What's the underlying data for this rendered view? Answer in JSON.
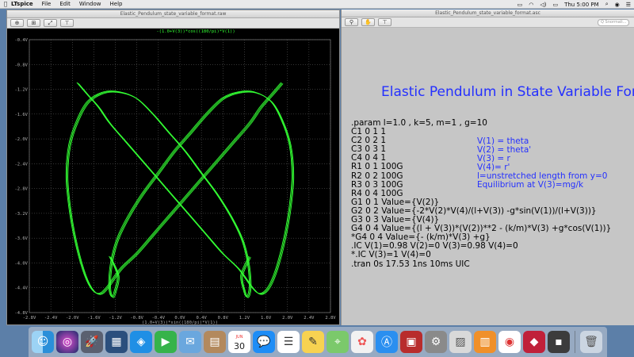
{
  "menubar": {
    "items": [
      "LTspice",
      "File",
      "Edit",
      "Window",
      "Help"
    ],
    "clock": "Thu 5:00 PM"
  },
  "waveform_window": {
    "title": "Elastic_Pendulum_state_variable_format.raw",
    "trace_label_top": "-(1.0+V(3))*cos((180/pi)*V(1))",
    "trace_label_bottom": "(1.0+V(3))*sin((180/pi)*V(1))",
    "trace_color": "#33ff33"
  },
  "schematic_window": {
    "title": "Elastic_Pendulum_state_variable_format.asc",
    "search_placeholder": "Q  Snormali...",
    "heading": "Elastic Pendulum in State Variable Forma",
    "netlist": [
      ".param l=1.0 , k=5, m=1 , g=10",
      "C1 0 1 1",
      "C2 0 2 1",
      "C3 0 3 1",
      "C4 0 4 1",
      "R1 0 1 100G",
      "R2 0 2 100G",
      "R3 0 3 100G",
      "R4 0 4 100G",
      "G1 0 1 Value={V(2)}",
      "G2 0 2 Value={-2*V(2)*V(4)/(l+V(3)) -g*sin(V(1))/(l+V(3))}",
      "G3 0 3 Value={V(4)}",
      "G4 0 4 Value={(l + V(3))*(V(2))**2 - (k/m)*V(3) +g*cos(V(1))}",
      "*G4 0 4 Value={- (k/m)*V(3) +g}",
      ".IC V(1)=0.98    V(2)=0  V(3)=0.98 V(4)=0",
      "*.IC  V(3)=1 V(4)=0",
      ".tran 0s 17.53 1ns  10ms UIC"
    ],
    "notes": [
      "V(1) = theta",
      "V(2) = theta'",
      "V(3) = r",
      "V(4)= r'",
      "l=unstretched length from y=0",
      "Equilibrium at V(3)=mg/k"
    ],
    "text_color": "#2430ff"
  },
  "chart_data": {
    "type": "line",
    "title": "-(1.0+V(3))*cos((180/pi)*V(1))",
    "xlabel": "(1.0+V(3))*sin((180/pi)*V(1))",
    "ylabel": "",
    "xlim": [
      -2.8,
      2.8
    ],
    "ylim": [
      -4.8,
      -0.4
    ],
    "x_ticks": [
      "-2.8V",
      "-2.4V",
      "-2.0V",
      "-1.6V",
      "-1.2V",
      "-0.8V",
      "-0.4V",
      "0.0V",
      "0.4V",
      "0.8V",
      "1.2V",
      "1.6V",
      "2.0V",
      "2.4V",
      "2.8V"
    ],
    "y_ticks": [
      "-0.4V",
      "-0.8V",
      "-1.2V",
      "-1.6V",
      "-2.0V",
      "-2.4V",
      "-2.8V",
      "-3.2V",
      "-3.6V",
      "-4.0V",
      "-4.4V",
      "-4.8V"
    ],
    "series": [
      {
        "x": [
          -1.9,
          -1.7,
          -1.5,
          -1.3,
          -1.0,
          -0.7,
          -0.4,
          -0.1,
          0.2,
          0.5,
          0.8,
          1.1,
          1.35,
          1.5,
          1.65,
          1.8,
          1.95,
          2.05,
          2.1,
          2.05,
          1.9,
          1.7,
          1.4,
          1.1,
          0.8,
          0.5,
          0.2,
          -0.1,
          -0.4,
          -0.7,
          -0.95,
          -1.15,
          -1.25,
          -1.3,
          -1.3,
          -1.25,
          -1.2,
          -1.15,
          -1.3
        ],
        "y": [
          -1.1,
          -1.3,
          -1.5,
          -1.75,
          -2.05,
          -2.35,
          -2.65,
          -2.95,
          -3.25,
          -3.55,
          -3.85,
          -4.1,
          -4.4,
          -4.5,
          -4.4,
          -4.1,
          -3.6,
          -3.1,
          -2.6,
          -2.1,
          -1.7,
          -1.4,
          -1.25,
          -1.25,
          -1.35,
          -1.6,
          -1.9,
          -2.2,
          -2.55,
          -2.9,
          -3.25,
          -3.6,
          -3.9,
          -4.2,
          -4.45,
          -4.55,
          -4.45,
          -4.2,
          -3.9
        ]
      },
      {
        "x": [
          1.9,
          1.7,
          1.5,
          1.3,
          1.0,
          0.7,
          0.4,
          0.1,
          -0.2,
          -0.5,
          -0.8,
          -1.1,
          -1.35,
          -1.5,
          -1.65,
          -1.8,
          -1.95,
          -2.05,
          -2.1,
          -2.05,
          -1.9,
          -1.7,
          -1.4,
          -1.1,
          -0.8,
          -0.5,
          -0.2,
          0.1,
          0.4,
          0.7,
          0.95,
          1.15,
          1.25,
          1.3,
          1.3,
          1.25,
          1.2,
          1.15,
          1.3
        ],
        "y": [
          -1.1,
          -1.3,
          -1.5,
          -1.75,
          -2.05,
          -2.35,
          -2.65,
          -2.95,
          -3.25,
          -3.55,
          -3.85,
          -4.1,
          -4.4,
          -4.5,
          -4.4,
          -4.1,
          -3.6,
          -3.1,
          -2.6,
          -2.1,
          -1.7,
          -1.4,
          -1.25,
          -1.25,
          -1.35,
          -1.6,
          -1.9,
          -2.2,
          -2.55,
          -2.9,
          -3.25,
          -3.6,
          -3.9,
          -4.2,
          -4.45,
          -4.55,
          -4.45,
          -4.2,
          -3.9
        ]
      }
    ],
    "grid": true,
    "line_color": "#33ff33",
    "background": "#000000"
  },
  "dock": {
    "icons": [
      "finder-icon",
      "siri-icon",
      "launchpad-icon",
      "ltspice-icon",
      "safari-icon",
      "facetime-icon",
      "mail-icon",
      "notes-icon",
      "calendar-icon",
      "messages-icon",
      "reminders-icon",
      "notes-app-icon",
      "maps-icon",
      "photos-icon",
      "app-store-icon",
      "photo-booth-icon",
      "system-preferences-icon",
      "preview-icon",
      "books-icon",
      "chrome-icon",
      "app-icon",
      "app2-icon",
      "trash-icon"
    ],
    "calendar_day": "30",
    "calendar_month": "JUN"
  }
}
